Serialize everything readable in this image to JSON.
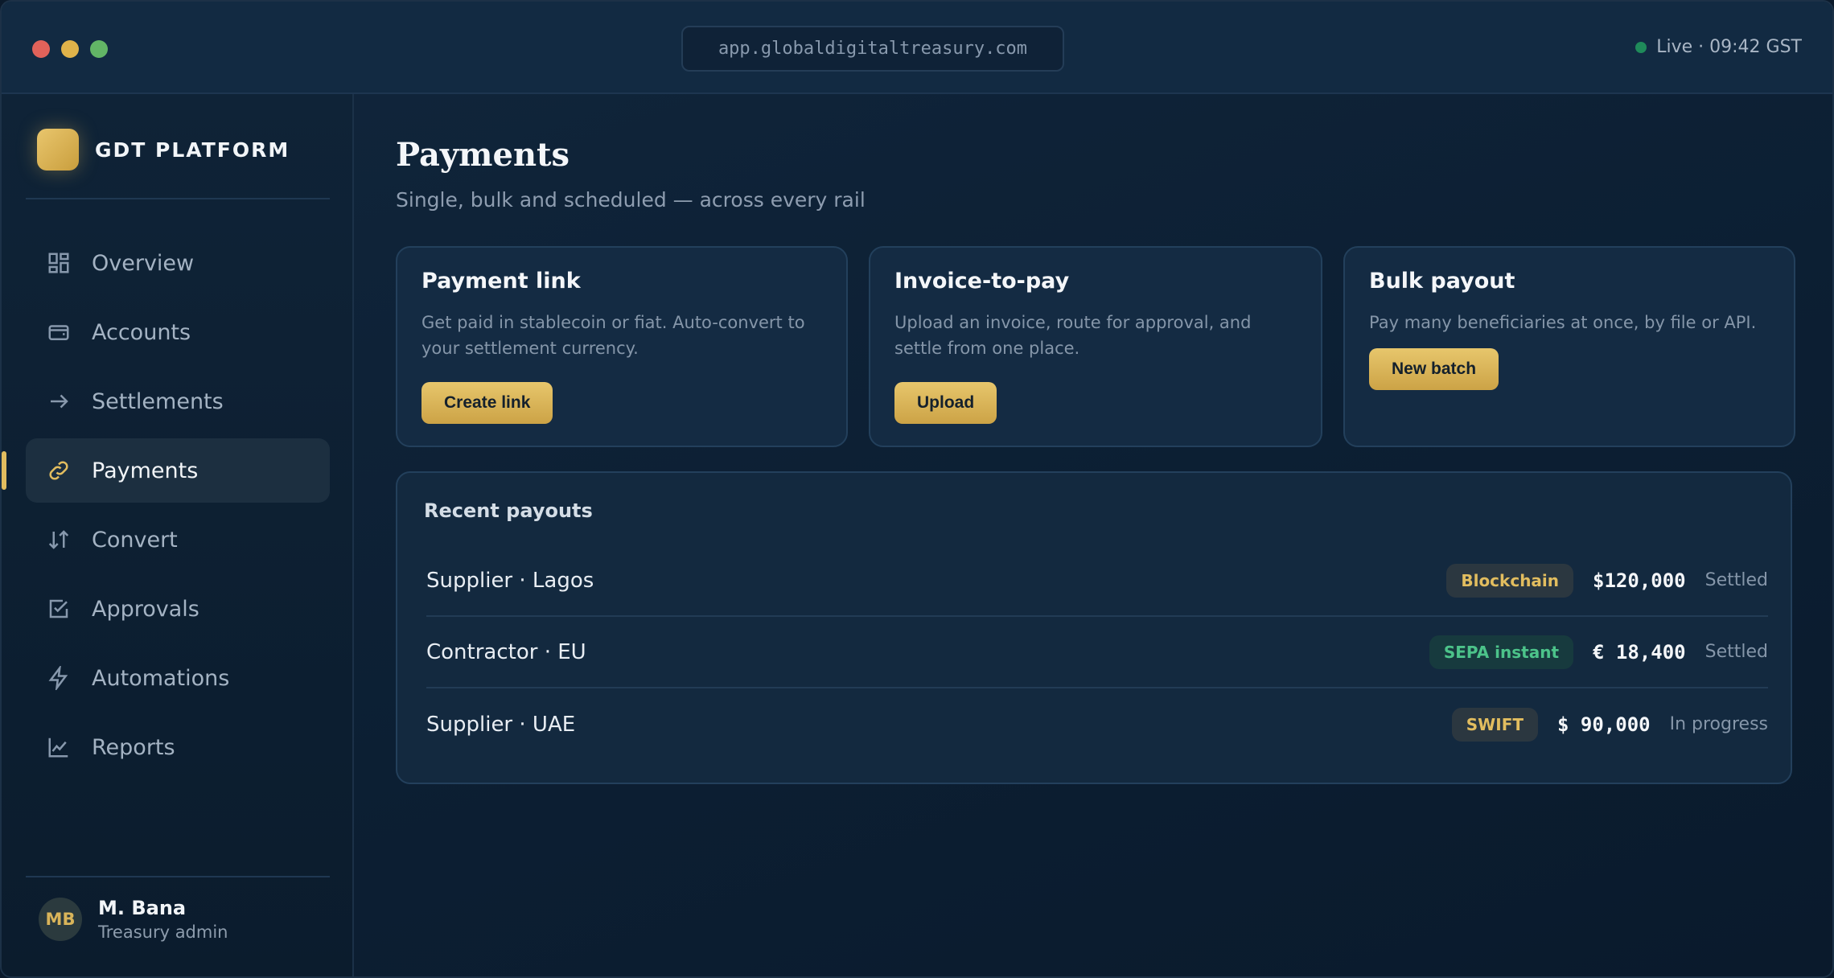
{
  "titlebar": {
    "url": "app.globaldigitaltreasury.com",
    "live_status": "Live · 09:42 GST"
  },
  "sidebar": {
    "brand": "GDT PLATFORM",
    "items": [
      {
        "label": "Overview",
        "icon": "grid-icon"
      },
      {
        "label": "Accounts",
        "icon": "wallet-icon"
      },
      {
        "label": "Settlements",
        "icon": "arrow-right-icon"
      },
      {
        "label": "Payments",
        "icon": "link-icon",
        "active": true
      },
      {
        "label": "Convert",
        "icon": "swap-arrows-icon"
      },
      {
        "label": "Approvals",
        "icon": "checkbox-icon"
      },
      {
        "label": "Automations",
        "icon": "lightning-icon"
      },
      {
        "label": "Reports",
        "icon": "line-chart-icon"
      }
    ],
    "user": {
      "initials": "MB",
      "name": "M. Bana",
      "role": "Treasury admin"
    }
  },
  "main": {
    "title": "Payments",
    "subtitle": "Single, bulk and scheduled — across every rail",
    "cards": [
      {
        "title": "Payment link",
        "description": "Get paid in stablecoin or fiat. Auto-convert to your settlement currency.",
        "button": "Create link"
      },
      {
        "title": "Invoice-to-pay",
        "description": "Upload an invoice, route for approval, and settle from one place.",
        "button": "Upload"
      },
      {
        "title": "Bulk payout",
        "description": "Pay many beneficiaries at once, by file or API.",
        "button": "New batch"
      }
    ],
    "recent": {
      "title": "Recent payouts",
      "rows": [
        {
          "name": "Supplier · Lagos",
          "rail": "Blockchain",
          "amount": "$120,000",
          "status": "Settled"
        },
        {
          "name": "Contractor · EU",
          "rail": "SEPA instant",
          "amount": "€ 18,400",
          "status": "Settled"
        },
        {
          "name": "Supplier · UAE",
          "rail": "SWIFT",
          "amount": "$ 90,000",
          "status": "In progress"
        }
      ]
    }
  },
  "colors": {
    "accent_gold": "#e2bd5f",
    "success_green": "#4cc38a",
    "live_dot": "#1f8a5a"
  }
}
